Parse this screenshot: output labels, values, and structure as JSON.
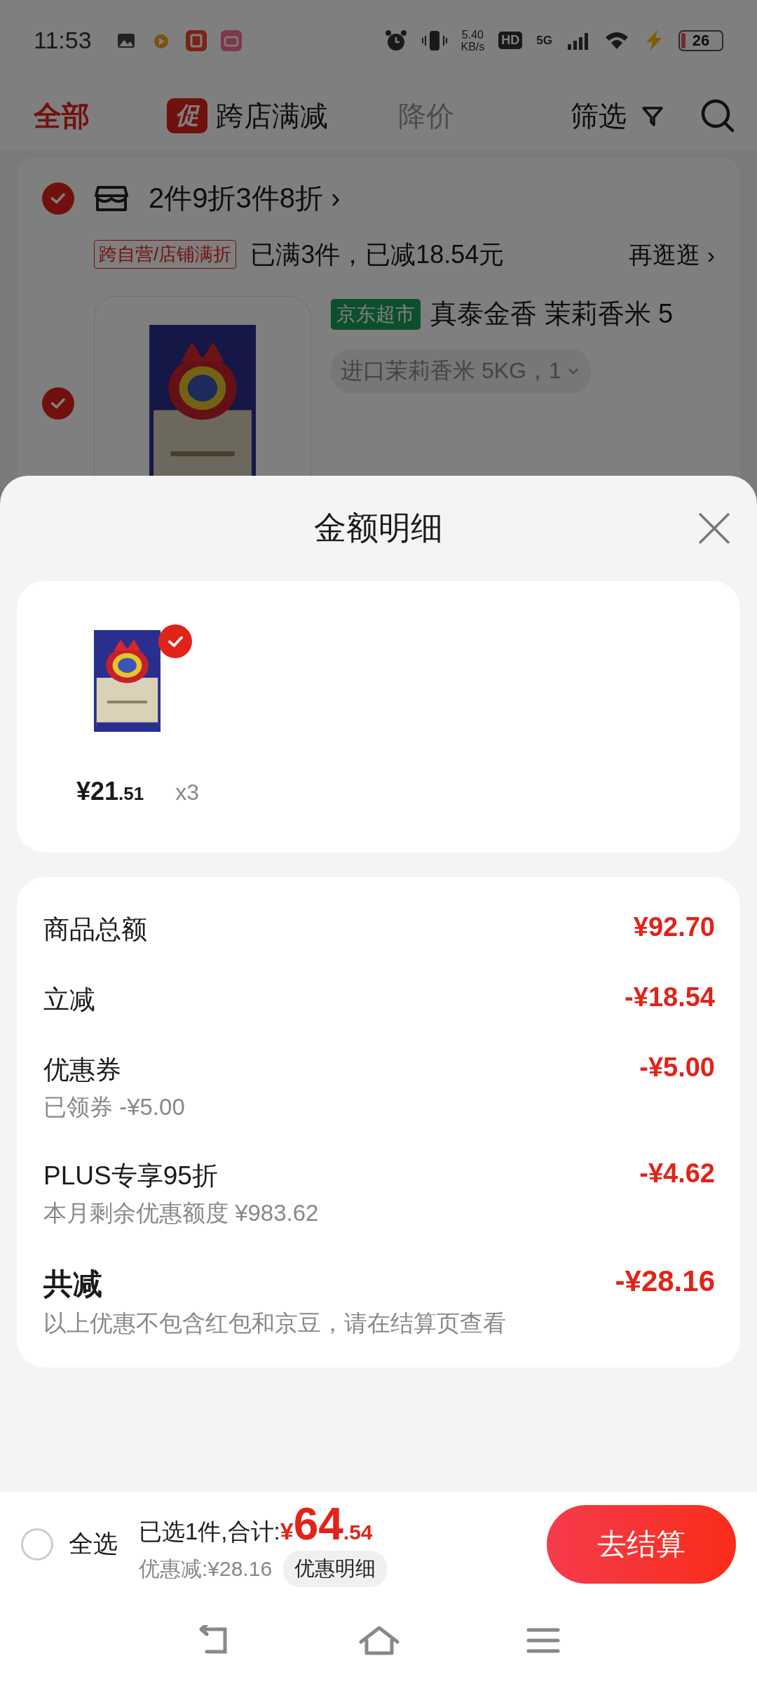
{
  "status_bar": {
    "time": "11:53",
    "net_speed": "5.40",
    "net_unit": "KB/s",
    "hd": "HD",
    "network": "5G",
    "battery": "26"
  },
  "tabs": [
    {
      "label": "全部",
      "selected": true
    },
    {
      "label": "跨店满减",
      "selected": false,
      "badge": "促"
    },
    {
      "label": "降价",
      "selected": false
    }
  ],
  "filter": "筛选",
  "cart": {
    "promo": {
      "checked": true,
      "title": "2件9折3件8折",
      "chevron": "›"
    },
    "tag": "跨自营/店铺满折",
    "progress": "已满3件，已减18.54元",
    "more": "再逛逛 ›",
    "item": {
      "checked": true,
      "store_tag": "京东超市",
      "title": "真泰金香 茉莉香米 5",
      "variant": "进口茉莉香米 5KG，1"
    }
  },
  "sheet": {
    "title": "金额明细",
    "products": [
      {
        "checked": true,
        "price": "¥21",
        "price_decimal": ".51",
        "quantity": "x3"
      }
    ],
    "rows": [
      {
        "kind": "normal",
        "label": "商品总额",
        "value": "¥92.70"
      },
      {
        "kind": "normal",
        "label": "立减",
        "value": "-¥18.54"
      },
      {
        "kind": "normal",
        "label": "优惠券",
        "value": "-¥5.00",
        "note": "已领券 -¥5.00"
      },
      {
        "kind": "normal",
        "label": "PLUS专享95折",
        "value": "-¥4.62",
        "note": "本月剩余优惠额度 ¥983.62"
      },
      {
        "kind": "total",
        "label": "共减",
        "value": "-¥28.16",
        "note": "以上优惠不包含红包和京豆，请在结算页查看"
      }
    ]
  },
  "bottom_bar": {
    "select_all": {
      "label": "全选",
      "checked": false
    },
    "selected_text": "已选1件,合计:",
    "currency": "¥",
    "total": "64",
    "total_decimal": ".54",
    "discount": "优惠减:¥28.16",
    "detail_button": "优惠明细",
    "checkout": "去结算"
  }
}
